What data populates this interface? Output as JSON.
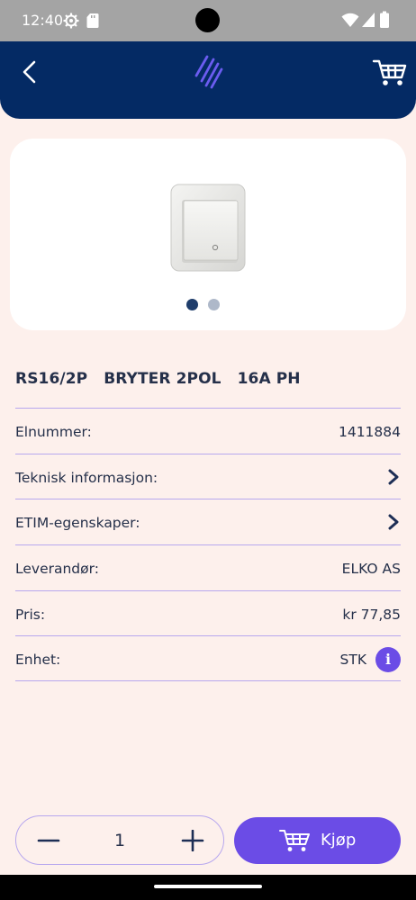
{
  "status_bar": {
    "time": "12:40",
    "icons": [
      "settings-icon",
      "sd-card-icon",
      "wifi-icon",
      "signal-icon",
      "battery-icon"
    ]
  },
  "header": {
    "back_icon": "back-arrow-icon",
    "logo_icon": "brand-logo-icon",
    "cart_icon": "cart-icon",
    "background": "#042a64"
  },
  "gallery": {
    "image_icon": "light-switch-image",
    "pages": 2,
    "active_page": 1
  },
  "product": {
    "title": "RS16/2P   BRYTER 2POL   16A PH"
  },
  "details": [
    {
      "label": "Elnummer:",
      "value": "1411884"
    },
    {
      "label": "Teknisk informasjon:",
      "value": ""
    },
    {
      "label": "ETIM-egenskaper:",
      "value": ""
    },
    {
      "label": "Leverandør:",
      "value": "ELKO AS"
    },
    {
      "label": "Pris:",
      "value": "kr 77,85"
    },
    {
      "label": "Enhet:",
      "value": "STK"
    }
  ],
  "info_glyph": "i",
  "quantity": {
    "value": "1"
  },
  "buy_button": {
    "label": "Kjøp",
    "icon": "cart-icon"
  },
  "colors": {
    "accent": "#6b4ce6",
    "primary": "#042a64",
    "background": "#fdf0ec",
    "divider": "#b7a7ee"
  }
}
